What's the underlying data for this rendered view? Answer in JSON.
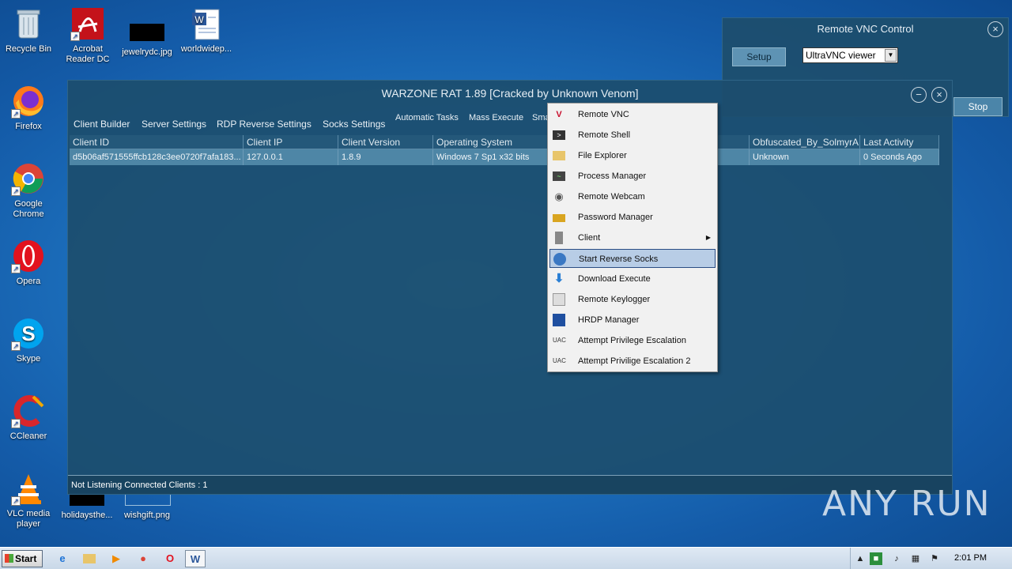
{
  "desktop": {
    "icons": [
      {
        "label": "Recycle Bin"
      },
      {
        "label": "Acrobat Reader DC"
      },
      {
        "label": "jewelrydc.jpg"
      },
      {
        "label": "worldwidep..."
      },
      {
        "label": "Firefox"
      },
      {
        "label": "Google Chrome"
      },
      {
        "label": "Opera"
      },
      {
        "label": "Skype"
      },
      {
        "label": "CCleaner"
      },
      {
        "label": "VLC media player"
      },
      {
        "label": "holidaysthe..."
      },
      {
        "label": "wishgift.png"
      }
    ]
  },
  "rat": {
    "title": "WARZONE RAT 1.89 [Cracked by Unknown Venom]",
    "menu": {
      "client_builder": "Client Builder",
      "server_settings": "Server Settings",
      "rdp_reverse": "RDP Reverse Settings",
      "socks": "Socks Settings",
      "automatic_tasks": "Automatic Tasks",
      "mass_execute": "Mass Execute",
      "sma": "Sma"
    },
    "columns": [
      "Client ID",
      "Client IP",
      "Client Version",
      "Operating System",
      "",
      "Obfuscated_By_SolmyrA",
      "Last Activity"
    ],
    "row": {
      "client_id": "d5b06af571555ffcb128c3ee0720f7afa183...",
      "client_ip": "127.0.0.1",
      "client_version": "1.8.9",
      "os": "Windows 7 Sp1 x32 bits",
      "obfuscated": "Unknown",
      "last_activity": "0 Seconds Ago"
    },
    "status": "Not Listening   Connected Clients : 1"
  },
  "vnc": {
    "title": "Remote VNC Control",
    "setup": "Setup",
    "viewer": "UltraVNC viewer",
    "stop": "Stop"
  },
  "context_menu": {
    "items": [
      {
        "label": "Remote VNC",
        "icon": "vnc-icon"
      },
      {
        "label": "Remote Shell",
        "icon": "shell-icon"
      },
      {
        "label": "File Explorer",
        "icon": "folder-icon"
      },
      {
        "label": "Process Manager",
        "icon": "process-icon"
      },
      {
        "label": "Remote Webcam",
        "icon": "webcam-icon"
      },
      {
        "label": "Password Manager",
        "icon": "lock-icon"
      },
      {
        "label": "Client",
        "icon": "client-icon"
      },
      {
        "label": "Start Reverse Socks",
        "icon": "globe-icon"
      },
      {
        "label": "Download  Execute",
        "icon": "download-icon"
      },
      {
        "label": "Remote Keylogger",
        "icon": "keylogger-icon"
      },
      {
        "label": "HRDP Manager",
        "icon": "hrdp-icon"
      },
      {
        "label": "Attempt Privilege Escalation",
        "icon": "uac-icon"
      },
      {
        "label": "Attempt Privilige Escalation 2",
        "icon": "uac-icon"
      }
    ],
    "uac": "UAC"
  },
  "taskbar": {
    "start": "Start",
    "clock": "2:01 PM"
  },
  "watermark": "ANY RUN"
}
